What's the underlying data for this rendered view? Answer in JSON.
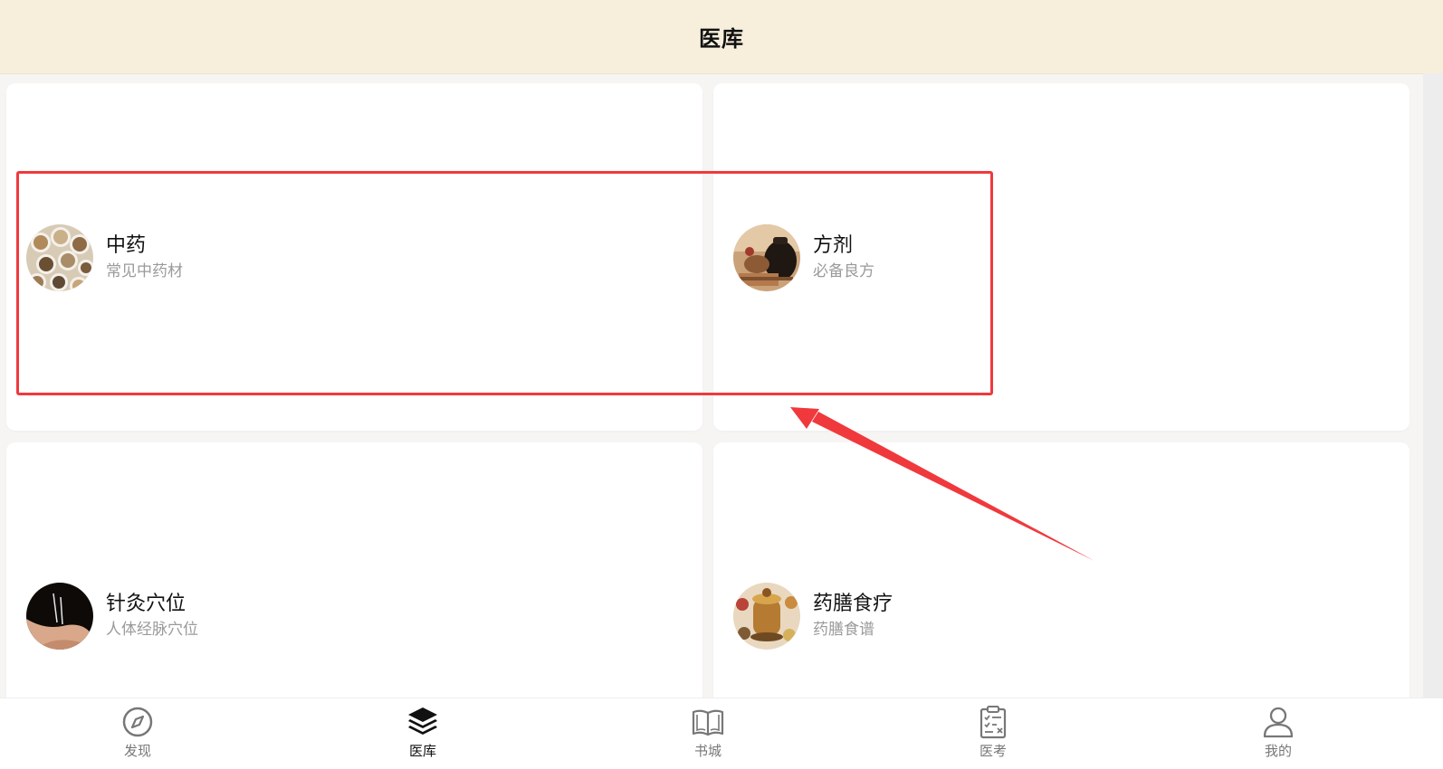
{
  "header": {
    "title": "医库"
  },
  "cards": [
    {
      "title": "中药",
      "subtitle": "常见中药材",
      "icon": "herbs-image"
    },
    {
      "title": "方剂",
      "subtitle": "必备良方",
      "icon": "prescription-image"
    },
    {
      "title": "针灸穴位",
      "subtitle": "人体经脉穴位",
      "icon": "acupuncture-image"
    },
    {
      "title": "药膳食疗",
      "subtitle": "药膳食谱",
      "icon": "medicinal-diet-image"
    }
  ],
  "tabs": [
    {
      "label": "发现",
      "icon": "compass-icon",
      "active": false
    },
    {
      "label": "医库",
      "icon": "layers-icon",
      "active": true
    },
    {
      "label": "书城",
      "icon": "book-icon",
      "active": false
    },
    {
      "label": "医考",
      "icon": "clipboard-icon",
      "active": false
    },
    {
      "label": "我的",
      "icon": "user-icon",
      "active": false
    }
  ],
  "colors": {
    "header_bg": "#f7efdc",
    "annotation_red": "#f0393d",
    "subtitle_gray": "#9a9a9a"
  }
}
